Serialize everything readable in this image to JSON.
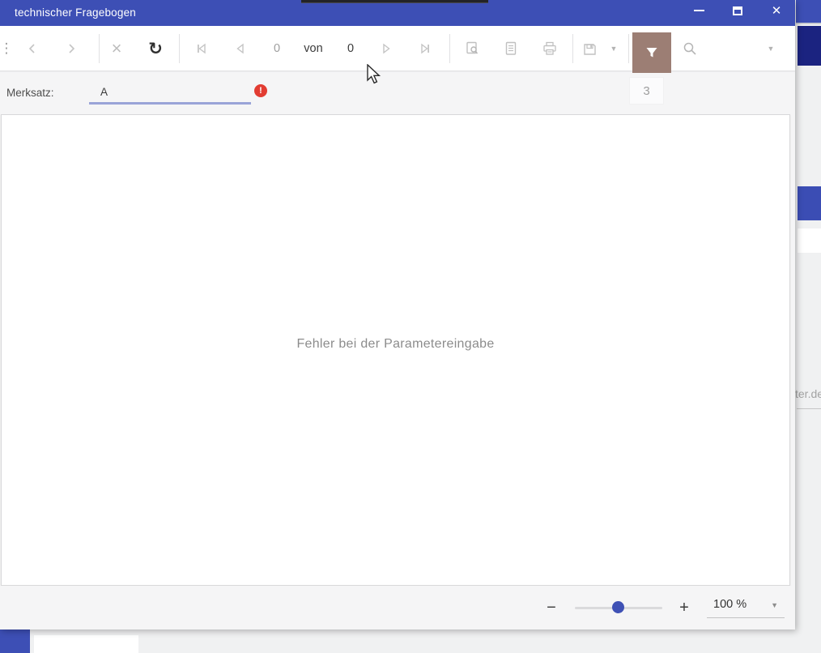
{
  "window": {
    "title": "technischer Fragebogen"
  },
  "toolbar": {
    "pager_current": "0",
    "pager_of_label": "von",
    "pager_total": "0",
    "search_value": ""
  },
  "parameters": {
    "label": "Merksatz:",
    "value": "A",
    "error_mark": "!",
    "counter_badge": "3"
  },
  "content": {
    "error_message": "Fehler bei der Parametereingabe"
  },
  "zoom_bar": {
    "minus_label": "−",
    "plus_label": "+",
    "zoom_level": "100 %",
    "dropdown_glyph": "▼"
  },
  "background_window": {
    "partial_text": "ter.de"
  },
  "icons": {
    "kebab": "⋮",
    "cancel": "×",
    "refresh": "↻",
    "search_dropdown": "▼",
    "close_window": "✕"
  },
  "colors": {
    "titlebar_blue": "#3d4fb5",
    "navy_accent": "#1b2380",
    "filter_button": "#9c7e74",
    "error_red": "#e23c32",
    "input_underline": "#9aa4d8",
    "slider_thumb": "#3f51b5"
  }
}
